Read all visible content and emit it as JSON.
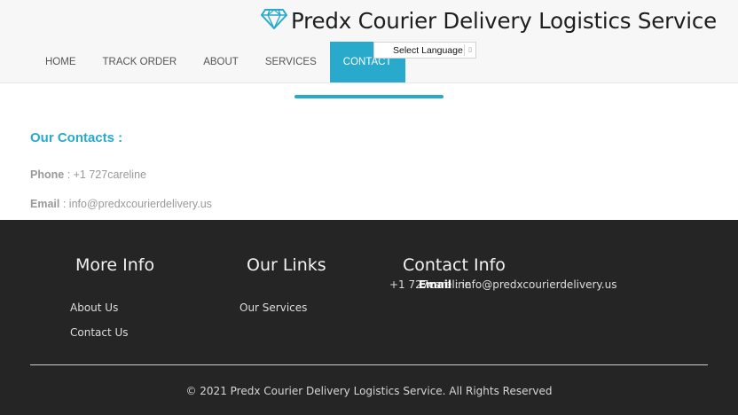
{
  "brand": {
    "name": "Predx Courier Delivery Logistics Service",
    "icon": "diamond-icon",
    "icon_color": "#29a9cc"
  },
  "nav": {
    "items": [
      {
        "label": "HOME"
      },
      {
        "label": "TRACK ORDER"
      },
      {
        "label": "ABOUT"
      },
      {
        "label": "SERVICES"
      },
      {
        "label": "CONTACT",
        "active": true
      }
    ],
    "active_color": "#29a9cc"
  },
  "language": {
    "selected": "Select Language"
  },
  "contacts": {
    "title": "Our Contacts :",
    "phone_label": "Phone",
    "phone_value": ": +1 727careline",
    "email_label": "Email",
    "email_value": ": info@predxcourierdelivery.us"
  },
  "footer": {
    "more_info": {
      "title": "More Info",
      "links": [
        "About Us",
        "Contact Us"
      ]
    },
    "our_links": {
      "title": "Our Links",
      "links": [
        "Our Services"
      ]
    },
    "contact_info": {
      "title": "Contact Info",
      "phone": "+1 727careline",
      "email_label": "Email",
      "email_value": ": info@predxcourierdelivery.us"
    },
    "copyright": "© 2021 Predx Courier Delivery Logistics Service. All Rights Reserved"
  }
}
